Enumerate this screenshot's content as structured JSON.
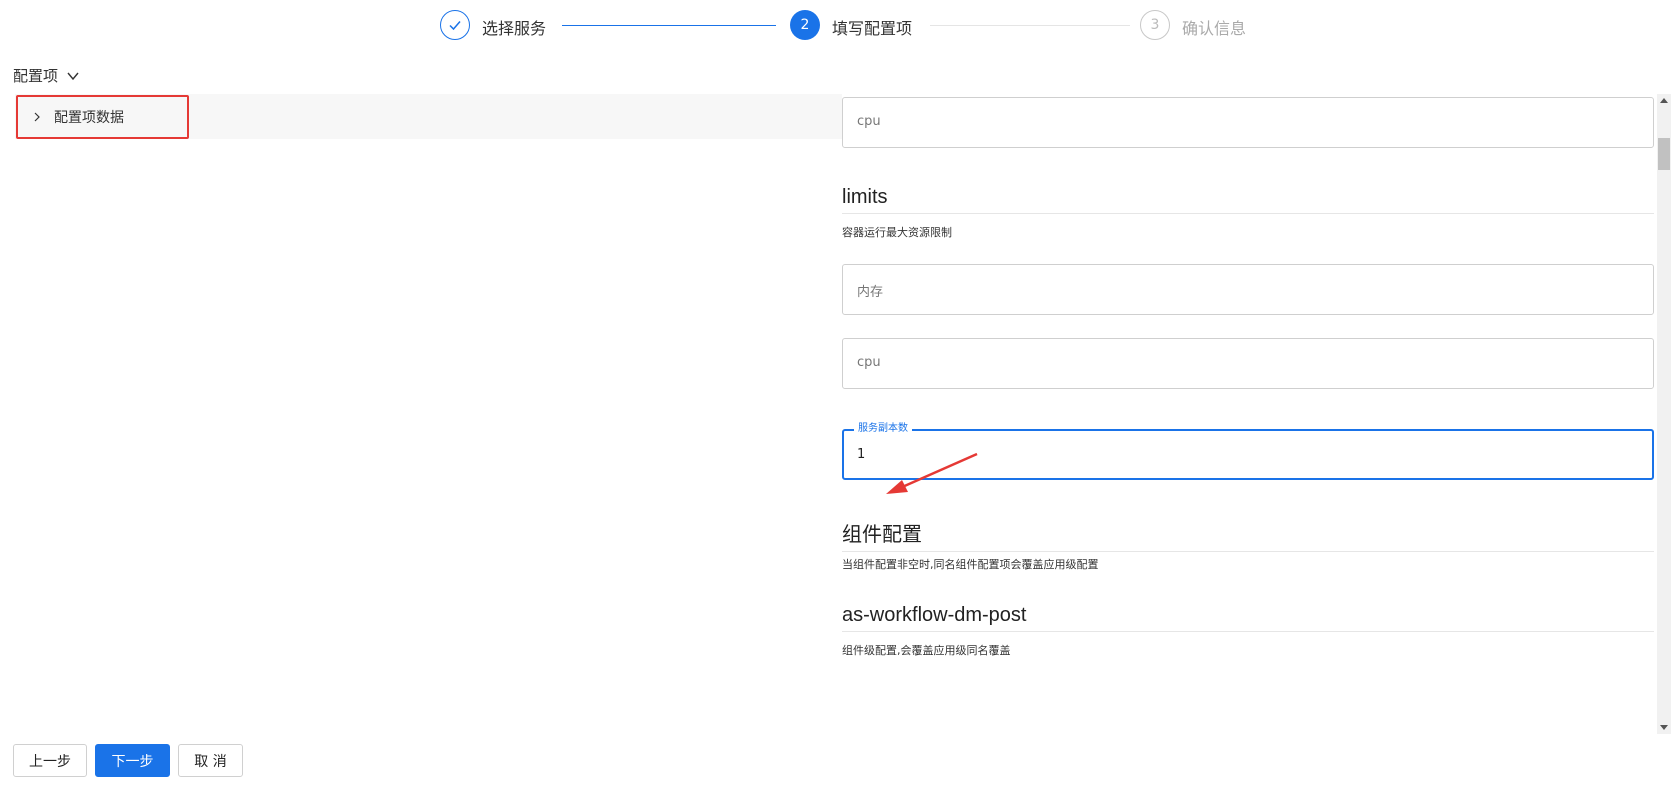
{
  "steps": [
    {
      "number": "✓",
      "label": "选择服务",
      "state": "done"
    },
    {
      "number": "2",
      "label": "填写配置项",
      "state": "active"
    },
    {
      "number": "3",
      "label": "确认信息",
      "state": "wait"
    }
  ],
  "left": {
    "section_label": "配置项",
    "tree_node_label": "配置项数据"
  },
  "form": {
    "field_cpu_top_placeholder": "cpu",
    "limits_title": "limits",
    "limits_desc": "容器运行最大资源限制",
    "field_memory_placeholder": "内存",
    "field_cpu_placeholder": "cpu",
    "replicas_label": "服务副本数",
    "replicas_value": "1",
    "component_title": "组件配置",
    "component_desc": "当组件配置非空时,同名组件配置项会覆盖应用级配置",
    "workflow_title": "as-workflow-dm-post",
    "workflow_desc": "组件级配置,会覆盖应用级同名覆盖"
  },
  "footer": {
    "prev_label": "上一步",
    "next_label": "下一步",
    "cancel_label": "取 消"
  },
  "colors": {
    "primary": "#1a73e8",
    "highlight_red": "#e53935"
  }
}
